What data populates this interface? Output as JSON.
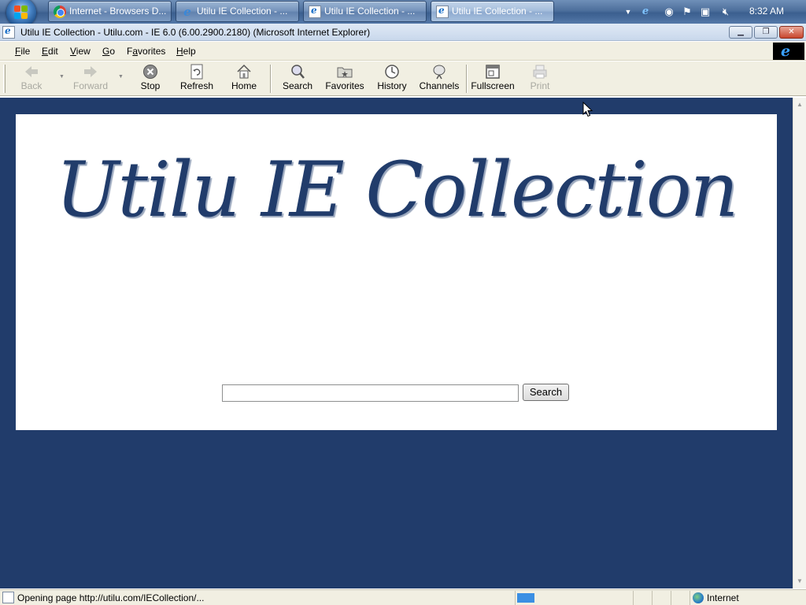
{
  "taskbar": {
    "tasks": [
      {
        "label": "Internet - Browsers D...",
        "icon": "chrome-icon"
      },
      {
        "label": "Utilu IE Collection - ...",
        "icon": "ie-icon"
      },
      {
        "label": "Utilu IE Collection - ...",
        "icon": "ie-page-icon"
      },
      {
        "label": "Utilu IE Collection - ...",
        "icon": "ie-page-icon",
        "active": true
      }
    ],
    "clock": "8:32 AM"
  },
  "window": {
    "title": "Utilu IE Collection - Utilu.com - IE 6.0 (6.00.2900.2180) (Microsoft Internet Explorer)"
  },
  "menu": {
    "items": [
      {
        "underline": "F",
        "rest": "ile"
      },
      {
        "underline": "E",
        "rest": "dit"
      },
      {
        "underline": "V",
        "rest": "iew"
      },
      {
        "underline": "G",
        "rest": "o"
      },
      {
        "underline": "",
        "pre": "F",
        "mid": "a",
        "rest": "vorites",
        "label": "Favorites"
      },
      {
        "underline": "H",
        "rest": "elp"
      }
    ]
  },
  "toolbar": {
    "back": "Back",
    "forward": "Forward",
    "stop": "Stop",
    "refresh": "Refresh",
    "home": "Home",
    "search": "Search",
    "favorites": "Favorites",
    "history": "History",
    "channels": "Channels",
    "fullscreen": "Fullscreen",
    "print": "Print"
  },
  "page": {
    "logo": "Utilu IE Collection",
    "search_value": "",
    "search_button": "Search",
    "colors": {
      "background": "#213c6b",
      "panel": "#ffffff",
      "logo": "#213c6b"
    }
  },
  "status": {
    "text": "Opening page http://utilu.com/IECollection/...",
    "zone": "Internet"
  }
}
